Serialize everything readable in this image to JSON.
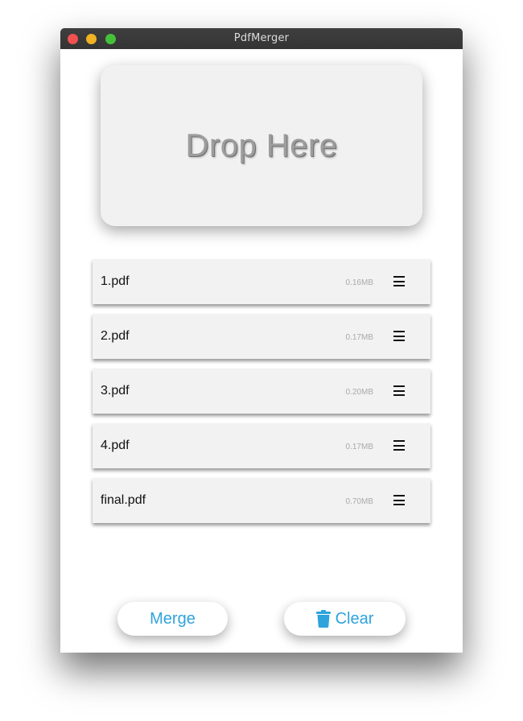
{
  "window": {
    "title": "PdfMerger"
  },
  "dropzone": {
    "label": "Drop Here"
  },
  "files": [
    {
      "name": "1.pdf",
      "size": "0.16MB"
    },
    {
      "name": "2.pdf",
      "size": "0.17MB"
    },
    {
      "name": "3.pdf",
      "size": "0.20MB"
    },
    {
      "name": "4.pdf",
      "size": "0.17MB"
    },
    {
      "name": "final.pdf",
      "size": "0.70MB"
    }
  ],
  "actions": {
    "merge_label": "Merge",
    "clear_label": "Clear",
    "clear_icon": "trash-icon",
    "accent_color": "#2ea3dc"
  }
}
